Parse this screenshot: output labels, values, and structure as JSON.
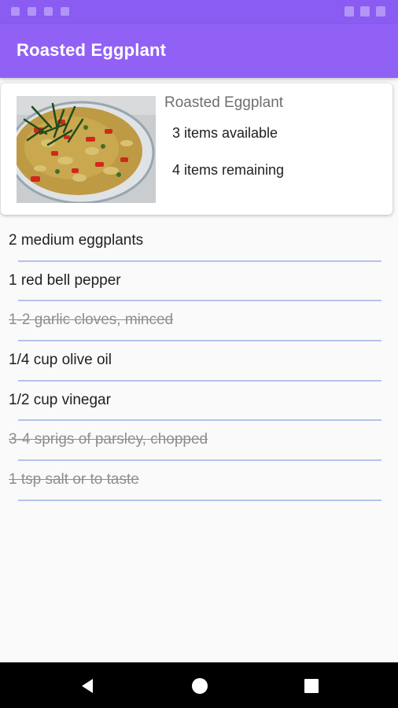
{
  "app_bar": {
    "title": "Roasted Eggplant"
  },
  "recipe_card": {
    "name": "Roasted Eggplant",
    "available": "3 items available",
    "remaining": "4 items remaining",
    "image_icon": "eggplant-salad-photo"
  },
  "ingredients": [
    {
      "text": "2 medium eggplants",
      "checked": false
    },
    {
      "text": "1 red bell pepper",
      "checked": false
    },
    {
      "text": "1-2 garlic cloves, minced",
      "checked": true
    },
    {
      "text": "1/4 cup olive oil",
      "checked": false
    },
    {
      "text": "1/2 cup vinegar",
      "checked": false
    },
    {
      "text": "3-4 sprigs of parsley, chopped",
      "checked": true
    },
    {
      "text": "1 tsp salt or to taste",
      "checked": true
    }
  ],
  "nav_bar": {
    "back_icon": "back-triangle-icon",
    "home_icon": "home-circle-icon",
    "recents_icon": "recents-square-icon"
  },
  "colors": {
    "status_bar": "#8a5cf2",
    "app_bar": "#9161f5",
    "divider": "#b4c2ee",
    "checked_text": "#8e8e8e",
    "background": "#fafafa"
  }
}
